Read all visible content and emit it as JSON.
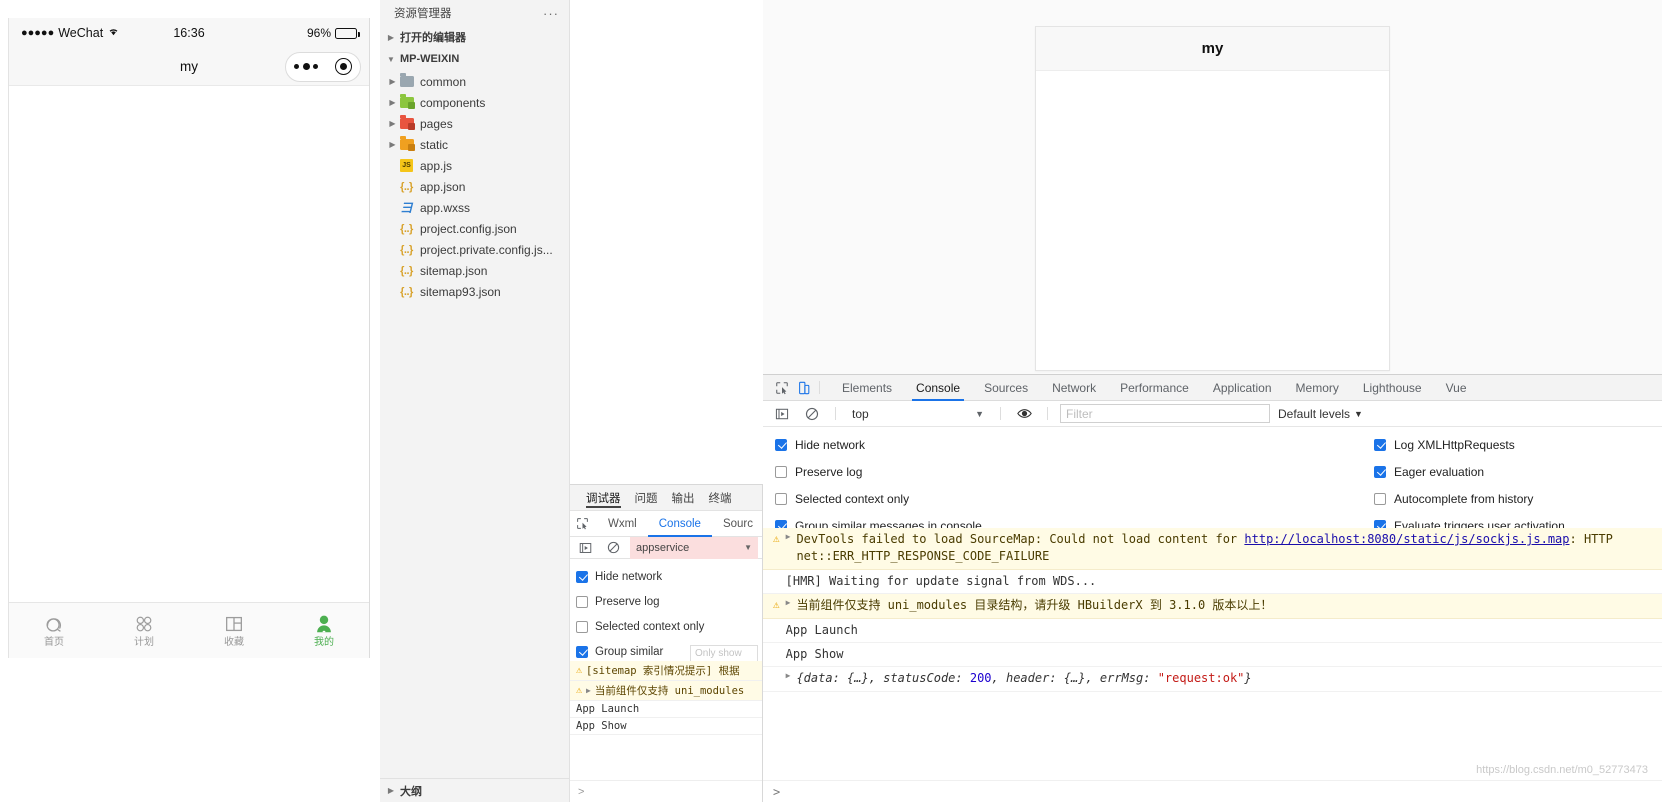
{
  "simulator": {
    "status_bar": {
      "dots": "●●●●●",
      "carrier": "WeChat",
      "wifi_icon": "wifi-icon",
      "time": "16:36",
      "battery_pct": "96%"
    },
    "nav": {
      "title": "my",
      "capsule_more_icon": "more-dots-icon",
      "capsule_target_icon": "target-icon"
    },
    "tabbar": [
      {
        "label": "首页",
        "icon": "home-icon",
        "active": false
      },
      {
        "label": "计划",
        "icon": "plan-grid-icon",
        "active": false
      },
      {
        "label": "收藏",
        "icon": "collection-icon",
        "active": false
      },
      {
        "label": "我的",
        "icon": "profile-person-icon",
        "active": true
      }
    ],
    "active_color": "#4caf50"
  },
  "explorer": {
    "title": "资源管理器",
    "more_icon": "ellipsis-icon",
    "open_editors": "打开的编辑器",
    "project": "MP-WEIXIN",
    "outline": "大纲",
    "nodes": [
      {
        "name": "common",
        "type": "folder",
        "icon": "folder-icon",
        "color": "#9aa7b0",
        "expandable": true
      },
      {
        "name": "components",
        "type": "folder",
        "icon": "folder-icon",
        "color": "#8cc63e",
        "expandable": true
      },
      {
        "name": "pages",
        "type": "folder",
        "icon": "folder-icon",
        "color": "#e8543f",
        "expandable": true
      },
      {
        "name": "static",
        "type": "folder",
        "icon": "folder-icon",
        "color": "#f0a020",
        "expandable": true
      },
      {
        "name": "app.js",
        "type": "js",
        "icon": "js-file-icon",
        "color": "#f5c518",
        "expandable": false
      },
      {
        "name": "app.json",
        "type": "json",
        "icon": "json-file-icon",
        "color": "#d8a22b",
        "expandable": false
      },
      {
        "name": "app.wxss",
        "type": "wxss",
        "icon": "wxss-file-icon",
        "color": "#2f7fd1",
        "expandable": false
      },
      {
        "name": "project.config.json",
        "type": "json",
        "icon": "json-file-icon",
        "color": "#d8a22b",
        "expandable": false
      },
      {
        "name": "project.private.config.js...",
        "type": "json",
        "icon": "json-file-icon",
        "color": "#d8a22b",
        "expandable": false
      },
      {
        "name": "sitemap.json",
        "type": "json",
        "icon": "json-file-icon",
        "color": "#d8a22b",
        "expandable": false
      },
      {
        "name": "sitemap93.json",
        "type": "json",
        "icon": "json-file-icon",
        "color": "#d8a22b",
        "expandable": false
      }
    ]
  },
  "inner_devtools": {
    "tabs": [
      {
        "label": "调试器",
        "active": true
      },
      {
        "label": "问题",
        "active": false
      },
      {
        "label": "输出",
        "active": false
      },
      {
        "label": "终端",
        "active": false
      }
    ],
    "subtabs": [
      {
        "label": "Wxml",
        "active": false
      },
      {
        "label": "Console",
        "active": true
      },
      {
        "label": "Sourc",
        "active": false
      }
    ],
    "inspect_icon": "inspect-cursor-icon",
    "execute_icon": "execute-icon",
    "clear_icon": "clear-console-icon",
    "context": "appservice",
    "dropdown_icon": "chevron-down-icon",
    "options": [
      {
        "label": "Hide network",
        "checked": true
      },
      {
        "label": "Preserve log",
        "checked": false
      },
      {
        "label": "Selected context only",
        "checked": false
      },
      {
        "label": "Group similar",
        "checked": true
      }
    ],
    "only_show_placeholder": "Only show",
    "messages": [
      {
        "level": "warn",
        "text": "[sitemap 索引情况提示] 根据",
        "expandable": false
      },
      {
        "level": "warn",
        "text": "当前组件仅支持 uni_modules",
        "expandable": true
      },
      {
        "level": "log",
        "text": "App Launch",
        "expandable": false
      },
      {
        "level": "log",
        "text": "App Show",
        "expandable": false
      }
    ],
    "prompt": ">"
  },
  "preview": {
    "title": "my"
  },
  "devtools": {
    "inspect_icon": "inspect-cursor-icon",
    "device_icon": "device-toolbar-icon",
    "tabs": [
      {
        "label": "Elements",
        "active": false
      },
      {
        "label": "Console",
        "active": true
      },
      {
        "label": "Sources",
        "active": false
      },
      {
        "label": "Network",
        "active": false
      },
      {
        "label": "Performance",
        "active": false
      },
      {
        "label": "Application",
        "active": false
      },
      {
        "label": "Memory",
        "active": false
      },
      {
        "label": "Lighthouse",
        "active": false
      },
      {
        "label": "Vue",
        "active": false
      }
    ],
    "filterbar": {
      "execute_icon": "execute-icon",
      "clear_icon": "clear-console-icon",
      "context": "top",
      "dropdown_icon": "chevron-down-icon",
      "eye_icon": "live-expression-icon",
      "filter_placeholder": "Filter",
      "levels_label": "Default levels",
      "levels_caret": "▼"
    },
    "options_left": [
      {
        "label": "Hide network",
        "checked": true
      },
      {
        "label": "Preserve log",
        "checked": false
      },
      {
        "label": "Selected context only",
        "checked": false
      },
      {
        "label": "Group similar messages in console",
        "checked": true
      }
    ],
    "options_right": [
      {
        "label": "Log XMLHttpRequests",
        "checked": true
      },
      {
        "label": "Eager evaluation",
        "checked": true
      },
      {
        "label": "Autocomplete from history",
        "checked": false
      },
      {
        "label": "Evaluate triggers user activation",
        "checked": true
      }
    ],
    "messages": [
      {
        "level": "warn",
        "expandable": true,
        "parts": [
          {
            "t": "DevTools failed to load SourceMap: Could not load content for ",
            "k": "plain"
          },
          {
            "t": "http://localhost:8080/static/js/sockjs.js.map",
            "k": "link"
          },
          {
            "t": ": HTTP",
            "k": "plain"
          }
        ],
        "line2": "net::ERR_HTTP_RESPONSE_CODE_FAILURE"
      },
      {
        "level": "log",
        "expandable": false,
        "parts": [
          {
            "t": "[HMR] Waiting for update signal from WDS...",
            "k": "plain"
          }
        ]
      },
      {
        "level": "warn",
        "expandable": true,
        "parts": [
          {
            "t": "当前组件仅支持 uni_modules 目录结构，请升级 HBuilderX 到 3.1.0 版本以上！",
            "k": "plain"
          }
        ]
      },
      {
        "level": "log",
        "expandable": false,
        "parts": [
          {
            "t": "App Launch",
            "k": "plain"
          }
        ]
      },
      {
        "level": "log",
        "expandable": false,
        "parts": [
          {
            "t": "App Show",
            "k": "plain"
          }
        ]
      },
      {
        "level": "log",
        "expandable": true,
        "parts": [
          {
            "t": "{data: {…}, statusCode: ",
            "k": "ital"
          },
          {
            "t": "200",
            "k": "num"
          },
          {
            "t": ", header: {…}, errMsg: ",
            "k": "ital"
          },
          {
            "t": "\"request:ok\"",
            "k": "str"
          },
          {
            "t": "}",
            "k": "ital"
          }
        ]
      }
    ],
    "prompt": ">"
  },
  "watermark": "https://blog.csdn.net/m0_52773473"
}
